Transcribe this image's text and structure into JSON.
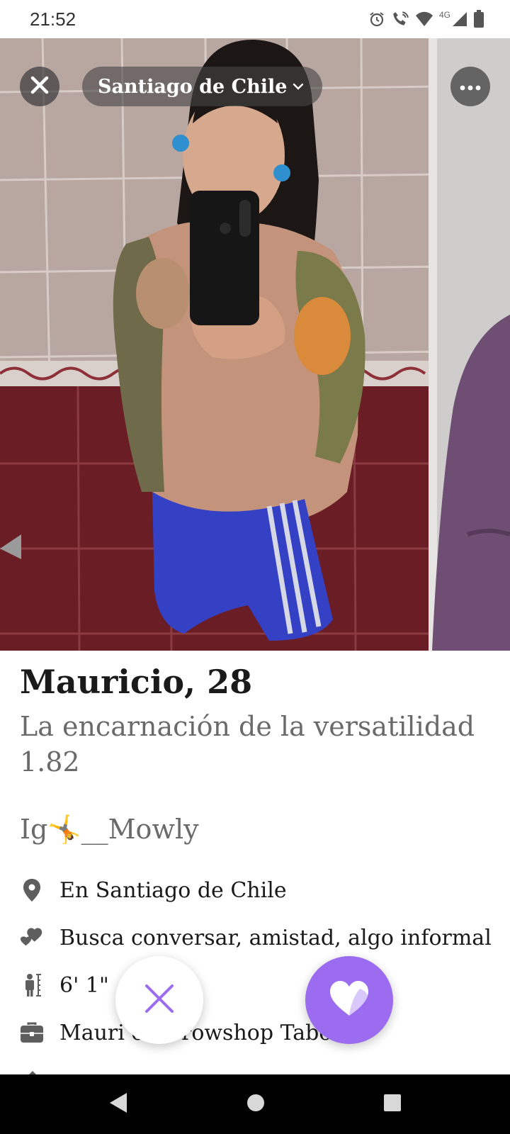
{
  "status_bar": {
    "time": "21:52",
    "network_label": "4G",
    "icons": [
      "alarm-icon",
      "wifi-calling-icon",
      "wifi-icon",
      "signal-icon",
      "battery-icon"
    ]
  },
  "header": {
    "location_label": "Santiago de Chile",
    "close_icon": "close-icon",
    "more_icon": "more-horizontal-icon"
  },
  "profile": {
    "name_age": "Mauricio, 28",
    "bio_line1": "La encarnación de la versatilidad",
    "bio_line2": "1.82",
    "instagram": "Ig🤸__Mowly",
    "details": [
      {
        "icon": "location-pin-icon",
        "text": "En Santiago de Chile"
      },
      {
        "icon": "hearts-icon",
        "text": "Busca conversar, amistad, algo informal"
      },
      {
        "icon": "height-icon",
        "text": "6' 1\""
      },
      {
        "icon": "briefcase-icon",
        "text": "Mauri en Growshop Taboo"
      }
    ]
  },
  "actions": {
    "dislike_icon": "x-icon",
    "like_icon": "heart-icon",
    "like_color": "#9b6cf0",
    "dislike_color": "#9b6cf0"
  },
  "nav": {
    "icons": [
      "back-icon",
      "home-icon",
      "recents-icon"
    ]
  }
}
